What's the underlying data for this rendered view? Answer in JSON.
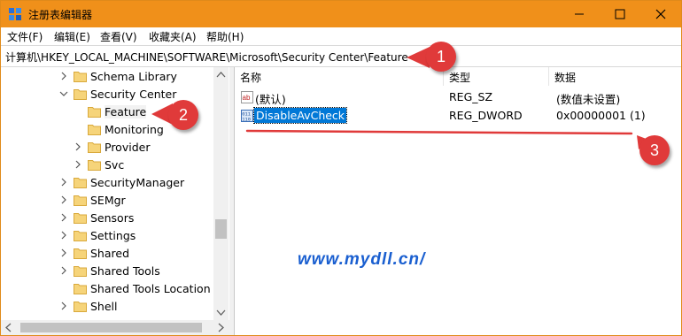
{
  "window": {
    "title": "注册表编辑器",
    "accent_color": "#f0901a",
    "controls": {
      "minimize_icon": "minimize-icon",
      "maximize_icon": "maximize-icon",
      "close_icon": "close-icon"
    }
  },
  "menu": [
    "文件(F)",
    "编辑(E)",
    "查看(V)",
    "收藏夹(A)",
    "帮助(H)"
  ],
  "address": {
    "path": "计算机\\HKEY_LOCAL_MACHINE\\SOFTWARE\\Microsoft\\Security Center\\Feature"
  },
  "tree": {
    "items": [
      {
        "label": "Schema Library",
        "expander": "collapsed"
      },
      {
        "label": "Security Center",
        "expander": "expanded"
      },
      {
        "label": "Feature",
        "expander": "none",
        "selected": true
      },
      {
        "label": "Monitoring",
        "expander": "none"
      },
      {
        "label": "Provider",
        "expander": "collapsed"
      },
      {
        "label": "Svc",
        "expander": "collapsed"
      },
      {
        "label": "SecurityManager",
        "expander": "collapsed"
      },
      {
        "label": "SEMgr",
        "expander": "collapsed"
      },
      {
        "label": "Sensors",
        "expander": "collapsed"
      },
      {
        "label": "Settings",
        "expander": "collapsed"
      },
      {
        "label": "Shared",
        "expander": "collapsed"
      },
      {
        "label": "Shared Tools",
        "expander": "collapsed"
      },
      {
        "label": "Shared Tools Location",
        "expander": "none"
      },
      {
        "label": "Shell",
        "expander": "collapsed"
      }
    ]
  },
  "list": {
    "columns": [
      "名称",
      "类型",
      "数据"
    ],
    "rows": [
      {
        "name": "(默认)",
        "type": "REG_SZ",
        "data": "(数值未设置)",
        "icon": "string-value-icon"
      },
      {
        "name": "DisableAvCheck",
        "type": "REG_DWORD",
        "data": "0x00000001 (1)",
        "icon": "binary-value-icon",
        "selected": true
      }
    ]
  },
  "callouts": [
    "1",
    "2",
    "3"
  ],
  "watermark": "www.mydll.cn/"
}
